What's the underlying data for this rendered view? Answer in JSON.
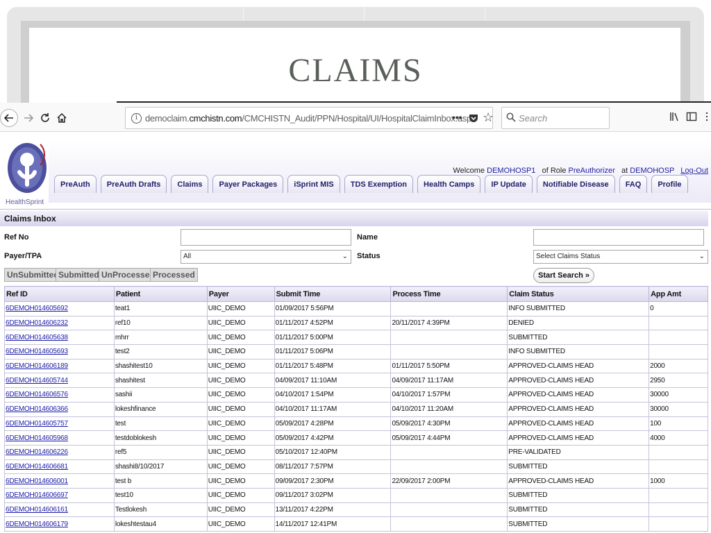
{
  "slide": {
    "title": "CLAIMS"
  },
  "browser": {
    "url_prefix": "democlaim.",
    "url_domain": "cmchistn.com",
    "url_path": "/CMCHISTN_Audit/PPN/Hospital/UI/HospitalClaimInbox.aspx",
    "search_placeholder": "Search",
    "icons": [
      "back-icon",
      "forward-icon",
      "reload-icon",
      "home-icon",
      "info-icon",
      "more-icon",
      "pocket-icon",
      "bookmark-star-icon",
      "search-icon",
      "library-icon",
      "sidebar-icon",
      "menu-icon"
    ]
  },
  "header": {
    "brand": "HealthSprint",
    "welcome_label": "Welcome",
    "user": "DEMOHOSP1",
    "role_label": "of Role",
    "role": "PreAuthorizer",
    "at_label": "at",
    "hospital": "DEMOHOSP",
    "logout": "Log-Out",
    "tabs": [
      "PreAuth",
      "PreAuth Drafts",
      "Claims",
      "Payer Packages",
      "iSprint MIS",
      "TDS Exemption",
      "Health Camps",
      "IP Update",
      "Notifiable Disease",
      "FAQ",
      "Profile"
    ]
  },
  "inbox": {
    "title": "Claims Inbox",
    "ref_no_label": "Ref No",
    "name_label": "Name",
    "payer_label": "Payer/TPA",
    "payer_value": "All",
    "status_label": "Status",
    "status_value": "Select Claims Status",
    "filters": [
      "UnSubmitted",
      "Submitted",
      "UnProcessed",
      "Processed"
    ],
    "start_search": "Start Search"
  },
  "table": {
    "columns": [
      "Ref ID",
      "Patient",
      "Payer",
      "Submit Time",
      "Process Time",
      "Claim Status",
      "App Amt"
    ],
    "rows": [
      [
        "6DEMOH014605692",
        "teat1",
        "UIIC_DEMO",
        "01/09/2017 5:56PM",
        "",
        "INFO SUBMITTED",
        "0"
      ],
      [
        "6DEMOH014606232",
        "ref10",
        "UIIC_DEMO",
        "01/11/2017 4:52PM",
        "20/11/2017 4:39PM",
        "DENIED",
        ""
      ],
      [
        "6DEMOH014605638",
        "mhrr",
        "UIIC_DEMO",
        "01/11/2017 5:00PM",
        "",
        "SUBMITTED",
        ""
      ],
      [
        "6DEMOH014605693",
        "test2",
        "UIIC_DEMO",
        "01/11/2017 5:06PM",
        "",
        "INFO SUBMITTED",
        ""
      ],
      [
        "6DEMOH014606189",
        "shashitest10",
        "UIIC_DEMO",
        "01/11/2017 5:48PM",
        "01/11/2017 5:50PM",
        "APPROVED-CLAIMS HEAD",
        "2000"
      ],
      [
        "6DEMOH014605744",
        "shashitest",
        "UIIC_DEMO",
        "04/09/2017 11:10AM",
        "04/09/2017 11:17AM",
        "APPROVED-CLAIMS HEAD",
        "2950"
      ],
      [
        "6DEMOH014606576",
        "sashii",
        "UIIC_DEMO",
        "04/10/2017 1:54PM",
        "04/10/2017 1:57PM",
        "APPROVED-CLAIMS HEAD",
        "30000"
      ],
      [
        "6DEMOH014606366",
        "lokeshfinance",
        "UIIC_DEMO",
        "04/10/2017 11:17AM",
        "04/10/2017 11:20AM",
        "APPROVED-CLAIMS HEAD",
        "30000"
      ],
      [
        "6DEMOH014605757",
        "test",
        "UIIC_DEMO",
        "05/09/2017 4:28PM",
        "05/09/2017 4:30PM",
        "APPROVED-CLAIMS HEAD",
        "100"
      ],
      [
        "6DEMOH014605968",
        "testdoblokesh",
        "UIIC_DEMO",
        "05/09/2017 4:42PM",
        "05/09/2017 4:44PM",
        "APPROVED-CLAIMS HEAD",
        "4000"
      ],
      [
        "6DEMOH014606226",
        "ref5",
        "UIIC_DEMO",
        "05/10/2017 12:40PM",
        "",
        "PRE-VALIDATED",
        ""
      ],
      [
        "6DEMOH014606681",
        "shashi8/10/2017",
        "UIIC_DEMO",
        "08/11/2017 7:57PM",
        "",
        "SUBMITTED",
        ""
      ],
      [
        "6DEMOH014606001",
        "test b",
        "UIIC_DEMO",
        "09/09/2017 2:30PM",
        "22/09/2017 2:00PM",
        "APPROVED-CLAIMS HEAD",
        "1000"
      ],
      [
        "6DEMOH014606697",
        "test10",
        "UIIC_DEMO",
        "09/11/2017 3:02PM",
        "",
        "SUBMITTED",
        ""
      ],
      [
        "6DEMOH014606161",
        "Testlokesh",
        "UIIC_DEMO",
        "13/11/2017 4:22PM",
        "",
        "SUBMITTED",
        ""
      ],
      [
        "6DEMOH014606179",
        "lokeshtestau4",
        "UIIC_DEMO",
        "14/11/2017 12:41PM",
        "",
        "SUBMITTED",
        ""
      ]
    ]
  },
  "colors": {
    "accent": "#20206a",
    "link": "#1a1aa8",
    "header_band": "#eceaf6"
  }
}
